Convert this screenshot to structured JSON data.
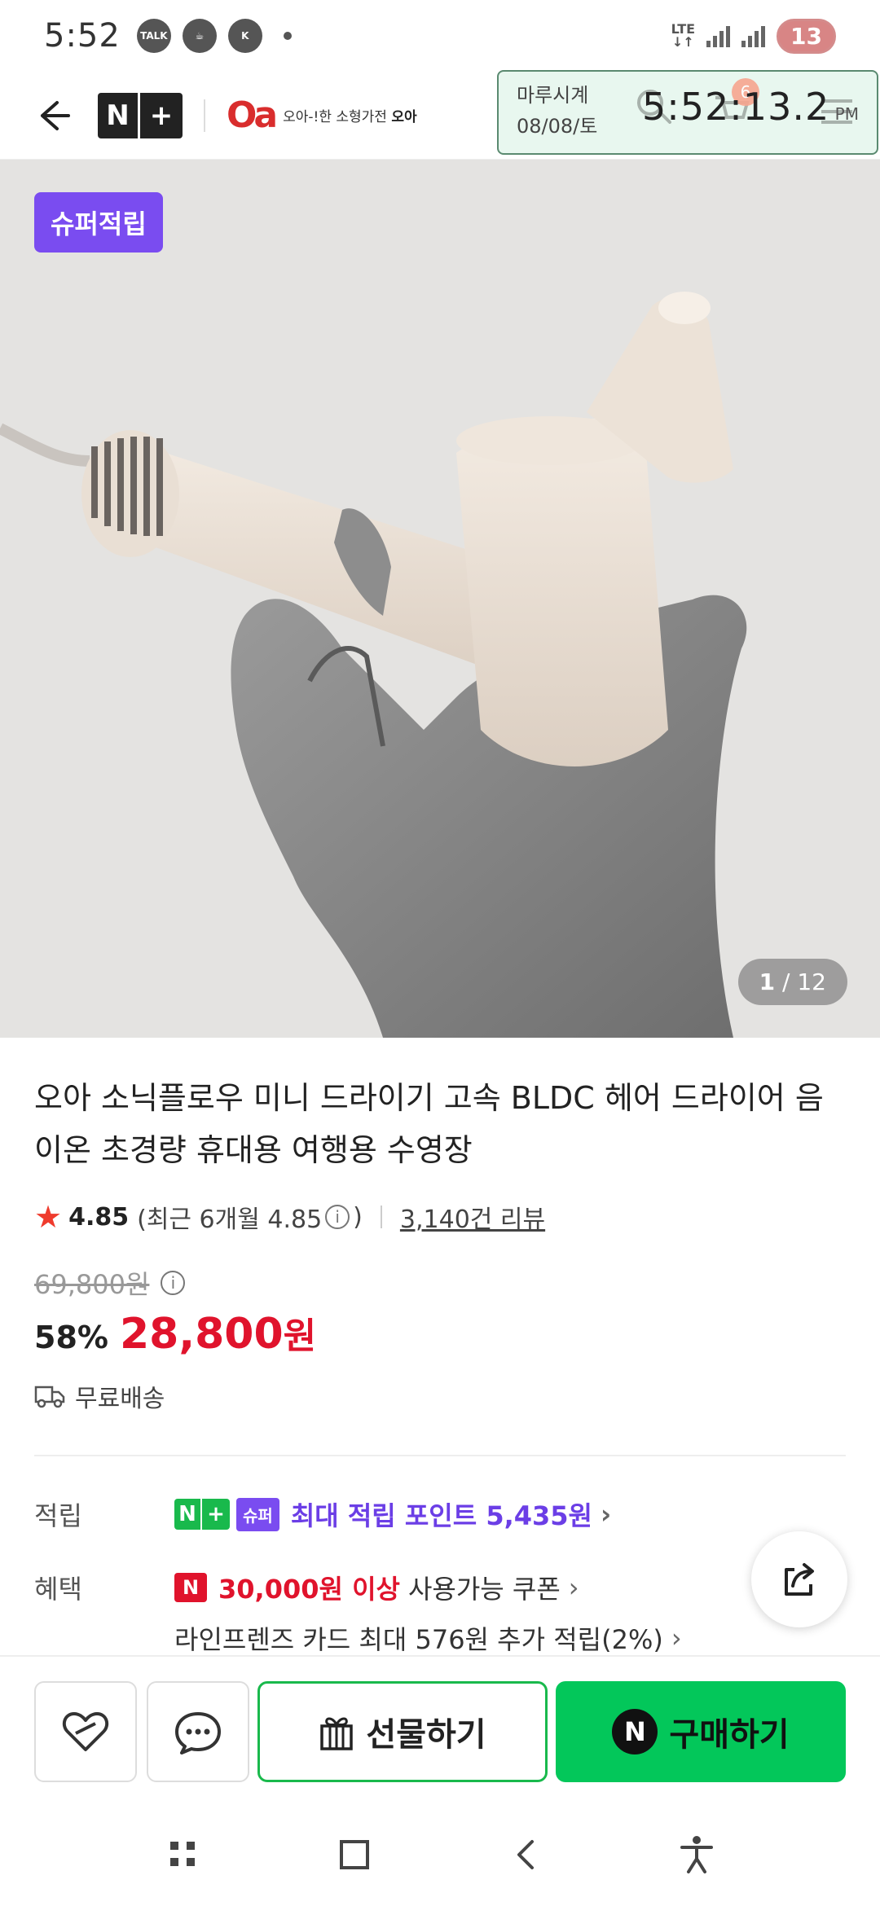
{
  "status_bar": {
    "time": "5:52",
    "talk_icon_label": "TALK",
    "k_icon_label": "K",
    "network": "LTE",
    "battery": "13"
  },
  "header": {
    "nplus_n": "N",
    "nplus_plus": "+",
    "brand_mark": "Oa",
    "brand_tagline": "오아-!한 소형가전",
    "brand_name": "오아"
  },
  "clock_widget": {
    "label": "마루시계",
    "date": "08/08/토",
    "time": "5:52:13.2",
    "ampm": "PM",
    "cart_count": "6"
  },
  "product_image": {
    "badge": "슈퍼적립",
    "counter_current": "1",
    "counter_total": "/ 12"
  },
  "product": {
    "title": "오아 소닉플로우 미니 드라이기 고속 BLDC 헤어 드라이어 음이온 초경량 휴대용 여행용 수영장",
    "rating": "4.85",
    "rating_recent_prefix": "(최근 6개월 4.85",
    "rating_recent_suffix": ")",
    "review_count": "3,140건 리뷰",
    "original_price": "69,800원",
    "discount": "58%",
    "price": "28,800",
    "price_unit": "원",
    "shipping": "무료배송"
  },
  "benefits": {
    "points_label": "적립",
    "super_tag": "슈퍼",
    "points_text": "최대 적립 포인트 5,435원",
    "benefit_label": "혜택",
    "coupon_n": "N",
    "coupon_amount": "30,000원 이상",
    "coupon_text": "사용가능 쿠폰",
    "card_text": "라인프렌즈 카드 최대 576원 추가 적립(2%)"
  },
  "actions": {
    "gift_label": "선물하기",
    "buy_label": "구매하기",
    "buy_n": "N"
  },
  "colors": {
    "accent_green": "#03c75a",
    "price_red": "#e0132c",
    "super_purple": "#7a4cf0"
  }
}
